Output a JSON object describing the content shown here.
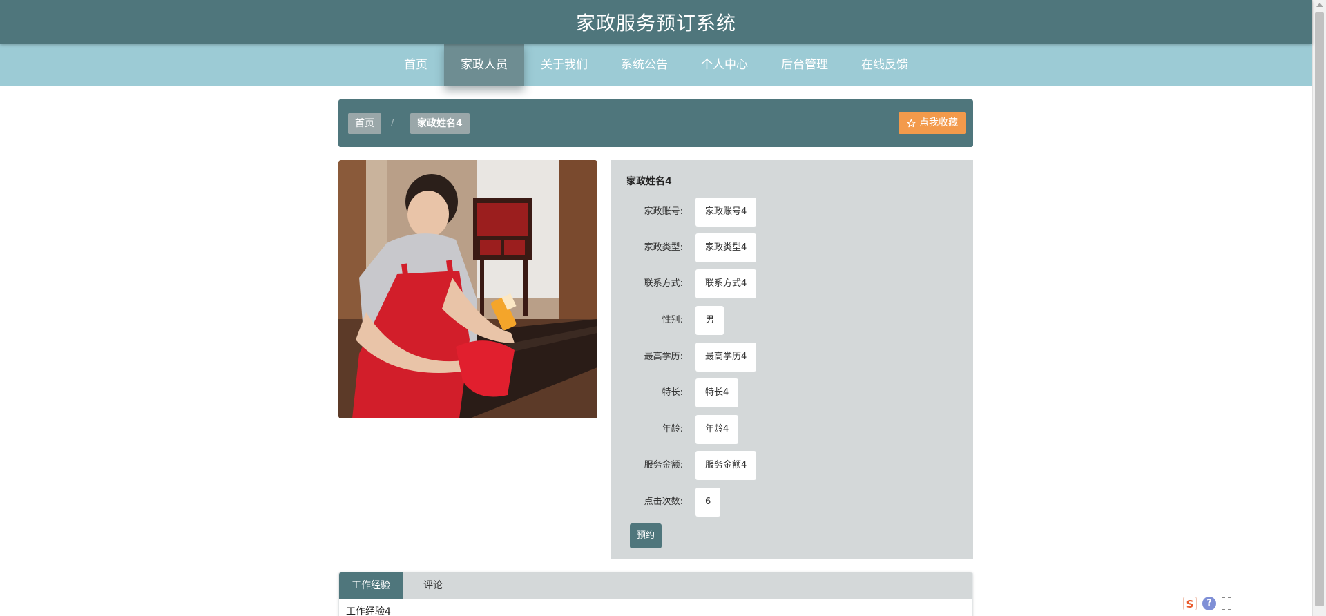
{
  "header": {
    "title": "家政服务预订系统"
  },
  "nav": {
    "items": [
      {
        "label": "首页"
      },
      {
        "label": "家政人员",
        "active": true
      },
      {
        "label": "关于我们"
      },
      {
        "label": "系统公告"
      },
      {
        "label": "个人中心"
      },
      {
        "label": "后台管理"
      },
      {
        "label": "在线反馈"
      }
    ]
  },
  "breadcrumb": {
    "home": "首页",
    "separator": "/",
    "current": "家政姓名4"
  },
  "favorite_button": {
    "label": "点我收藏",
    "icon": "star-outline-icon",
    "color": "#f39a4b"
  },
  "photo": {
    "description_icon": "housekeeper-photo"
  },
  "detail": {
    "name": "家政姓名4",
    "fields": [
      {
        "label": "家政账号:",
        "value": "家政账号4"
      },
      {
        "label": "家政类型:",
        "value": "家政类型4"
      },
      {
        "label": "联系方式:",
        "value": "联系方式4"
      },
      {
        "label": "性别:",
        "value": "男"
      },
      {
        "label": "最高学历:",
        "value": "最高学历4"
      },
      {
        "label": "特长:",
        "value": "特长4"
      },
      {
        "label": "年龄:",
        "value": "年龄4"
      },
      {
        "label": "服务金额:",
        "value": "服务金额4"
      },
      {
        "label": "点击次数:",
        "value": "6"
      }
    ],
    "book_button": "预约"
  },
  "tabs": {
    "items": [
      {
        "label": "工作经验",
        "active": true
      },
      {
        "label": "评论"
      }
    ],
    "content": "工作经验4"
  },
  "colors": {
    "primary": "#4f767c",
    "nav_bg": "#9ccbd5",
    "panel_bg": "#d4d8d9",
    "accent": "#f39a4b"
  }
}
